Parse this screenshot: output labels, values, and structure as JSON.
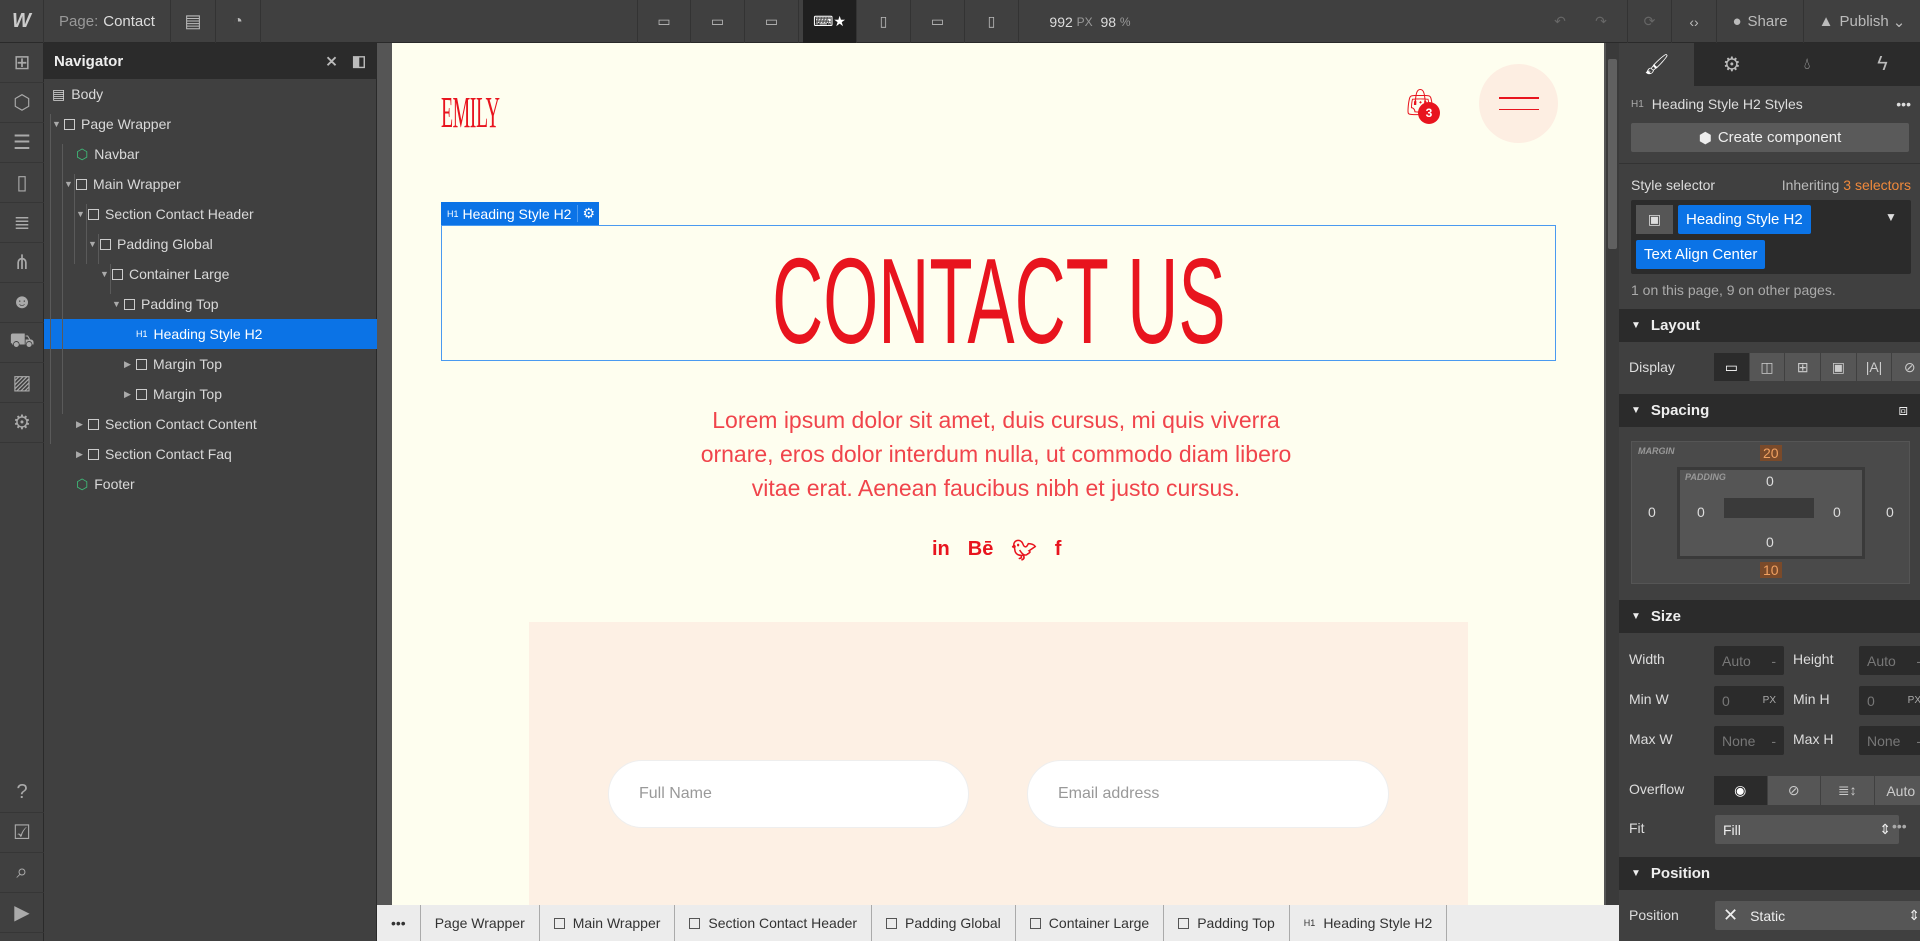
{
  "topbar": {
    "logo": "W",
    "page_label": "Page:",
    "page_name": "Contact",
    "width_value": "992",
    "width_unit": "PX",
    "zoom_value": "98",
    "zoom_unit": "%",
    "share": "Share",
    "publish": "Publish"
  },
  "navigator": {
    "title": "Navigator",
    "items": [
      {
        "label": "Body",
        "depth": 0,
        "type": "body"
      },
      {
        "label": "Page Wrapper",
        "depth": 0,
        "type": "box",
        "caret": true
      },
      {
        "label": "Navbar",
        "depth": 1,
        "type": "component"
      },
      {
        "label": "Main Wrapper",
        "depth": 1,
        "type": "box",
        "caret": true
      },
      {
        "label": "Section Contact Header",
        "depth": 2,
        "type": "box",
        "caret": true
      },
      {
        "label": "Padding Global",
        "depth": 3,
        "type": "box",
        "caret": true
      },
      {
        "label": "Container Large",
        "depth": 4,
        "type": "box",
        "caret": true
      },
      {
        "label": "Padding Top",
        "depth": 5,
        "type": "box",
        "caret": true
      },
      {
        "label": "Heading Style H2",
        "depth": 6,
        "type": "h1",
        "selected": true
      },
      {
        "label": "Margin Top",
        "depth": 6,
        "type": "box",
        "caret": "right"
      },
      {
        "label": "Margin Top",
        "depth": 6,
        "type": "box",
        "caret": "right"
      },
      {
        "label": "Section Contact Content",
        "depth": 2,
        "type": "box",
        "caret": "right"
      },
      {
        "label": "Section Contact Faq",
        "depth": 2,
        "type": "box",
        "caret": "right"
      },
      {
        "label": "Footer",
        "depth": 1,
        "type": "component"
      }
    ]
  },
  "canvas": {
    "brand": "EMILY",
    "cart_count": "3",
    "selection_tag": "Heading Style H2",
    "heading": "CONTACT US",
    "paragraph": "Lorem ipsum dolor sit amet, duis cursus, mi quis viverra ornare, eros dolor interdum nulla, ut commodo diam libero vitae erat. Aenean faucibus nibh et justo cursus.",
    "social": [
      "in",
      "Bē",
      "twitter",
      "f"
    ],
    "form": {
      "name_placeholder": "Full Name",
      "email_placeholder": "Email address"
    },
    "colors": {
      "accent": "#e8141e",
      "page_bg": "#fefeef",
      "form_bg": "#fdf0e4"
    }
  },
  "breadcrumbs": [
    "Page Wrapper",
    "Main Wrapper",
    "Section Contact Header",
    "Padding Global",
    "Container Large",
    "Padding Top",
    "Heading Style H2"
  ],
  "style_panel": {
    "element_title": "Heading Style H2 Styles",
    "create_component": "Create component",
    "style_selector": "Style selector",
    "inheriting": "Inheriting",
    "inherit_count": "3 selectors",
    "selectors": [
      "Heading Style H2",
      "Text Align Center"
    ],
    "usage": "1 on this page, 9 on other pages.",
    "layout": {
      "title": "Layout",
      "display_label": "Display"
    },
    "spacing": {
      "title": "Spacing",
      "margin_label": "MARGIN",
      "padding_label": "PADDING",
      "margin": {
        "top": "20",
        "right": "0",
        "bottom": "10",
        "left": "0"
      },
      "padding": {
        "top": "0",
        "right": "0",
        "bottom": "0",
        "left": "0"
      }
    },
    "size": {
      "title": "Size",
      "width": "Width",
      "width_val": "Auto",
      "height": "Height",
      "height_val": "Auto",
      "minw": "Min W",
      "minw_val": "0",
      "minh": "Min H",
      "minh_val": "0",
      "maxw": "Max W",
      "maxw_val": "None",
      "maxh": "Max H",
      "maxh_val": "None",
      "unit_px": "PX",
      "dash": "-",
      "overflow": "Overflow",
      "overflow_auto": "Auto",
      "fit": "Fit",
      "fit_val": "Fill"
    },
    "position": {
      "title": "Position",
      "label": "Position",
      "value": "Static"
    }
  }
}
